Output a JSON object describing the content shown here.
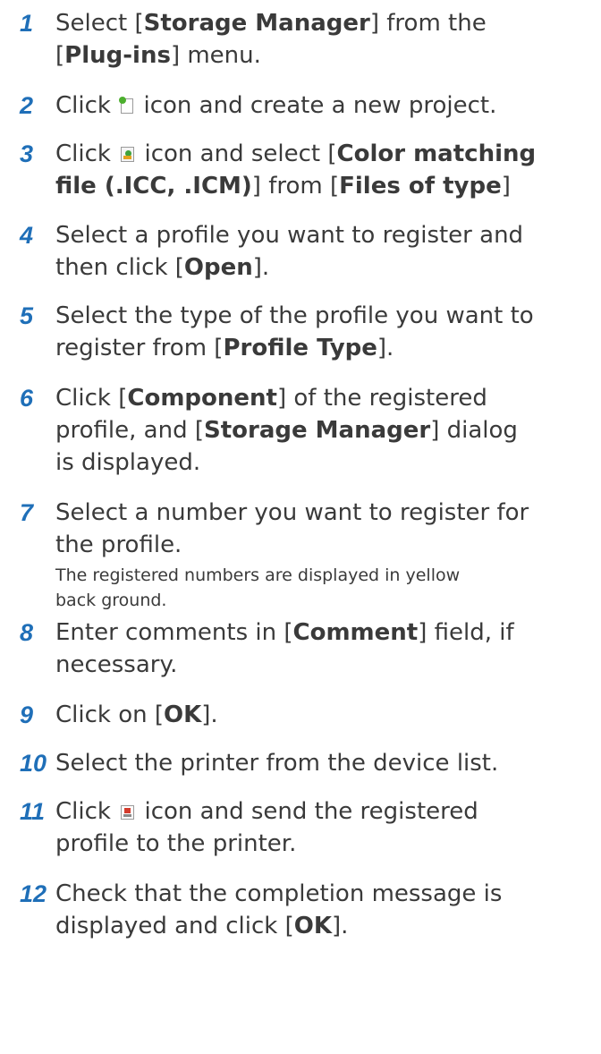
{
  "steps": [
    {
      "num": "1",
      "lines": [
        [
          {
            "t": "Select ["
          },
          {
            "t": "Storage Manager",
            "b": 1
          },
          {
            "t": "] from the"
          }
        ],
        [
          {
            "t": "["
          },
          {
            "t": "Plug-ins",
            "b": 1
          },
          {
            "t": "] menu."
          }
        ]
      ]
    },
    {
      "num": "2",
      "lines": [
        [
          {
            "t": "Click "
          },
          {
            "icon": "new-project-icon"
          },
          {
            "t": " icon and create a new project."
          }
        ]
      ]
    },
    {
      "num": "3",
      "lines": [
        [
          {
            "t": "Click "
          },
          {
            "icon": "add-file-icon"
          },
          {
            "t": " icon and select ["
          },
          {
            "t": "Color matching",
            "b": 1
          }
        ],
        [
          {
            "t": "file (.ICC, .ICM)",
            "b": 1
          },
          {
            "t": "] from ["
          },
          {
            "t": "Files of type",
            "b": 1
          },
          {
            "t": "]"
          }
        ]
      ]
    },
    {
      "num": "4",
      "lines": [
        [
          {
            "t": "Select a profile you want to register and"
          }
        ],
        [
          {
            "t": "then click ["
          },
          {
            "t": "Open",
            "b": 1
          },
          {
            "t": "]."
          }
        ]
      ]
    },
    {
      "num": "5",
      "lines": [
        [
          {
            "t": "Select the type of the profile you want to"
          }
        ],
        [
          {
            "t": "register from ["
          },
          {
            "t": "Profile Type",
            "b": 1
          },
          {
            "t": "]."
          }
        ]
      ]
    },
    {
      "num": "6",
      "lines": [
        [
          {
            "t": "Click ["
          },
          {
            "t": "Component",
            "b": 1
          },
          {
            "t": "] of the registered"
          }
        ],
        [
          {
            "t": "profile, and ["
          },
          {
            "t": "Storage Manager",
            "b": 1
          },
          {
            "t": "] dialog"
          }
        ],
        [
          {
            "t": "is displayed."
          }
        ]
      ]
    },
    {
      "num": "7",
      "lines": [
        [
          {
            "t": "Select a number you want to register for"
          }
        ],
        [
          {
            "t": "the profile."
          }
        ]
      ],
      "note": [
        "The registered numbers are displayed in yellow",
        "back ground."
      ]
    },
    {
      "num": "8",
      "lines": [
        [
          {
            "t": "Enter comments in ["
          },
          {
            "t": "Comment",
            "b": 1
          },
          {
            "t": "] field, if"
          }
        ],
        [
          {
            "t": "necessary."
          }
        ]
      ]
    },
    {
      "num": "9",
      "lines": [
        [
          {
            "t": "Click on ["
          },
          {
            "t": "OK",
            "b": 1
          },
          {
            "t": "]."
          }
        ]
      ]
    },
    {
      "num": "10",
      "lines": [
        [
          {
            "t": "Select the printer from the device list."
          }
        ]
      ]
    },
    {
      "num": "11",
      "lines": [
        [
          {
            "t": "Click "
          },
          {
            "icon": "send-to-printer-icon"
          },
          {
            "t": " icon and send the registered"
          }
        ],
        [
          {
            "t": "profile to the printer."
          }
        ]
      ]
    },
    {
      "num": "12",
      "lines": [
        [
          {
            "t": "Check that the completion message is"
          }
        ],
        [
          {
            "t": "displayed and click ["
          },
          {
            "t": "OK",
            "b": 1
          },
          {
            "t": "]."
          }
        ]
      ]
    }
  ]
}
